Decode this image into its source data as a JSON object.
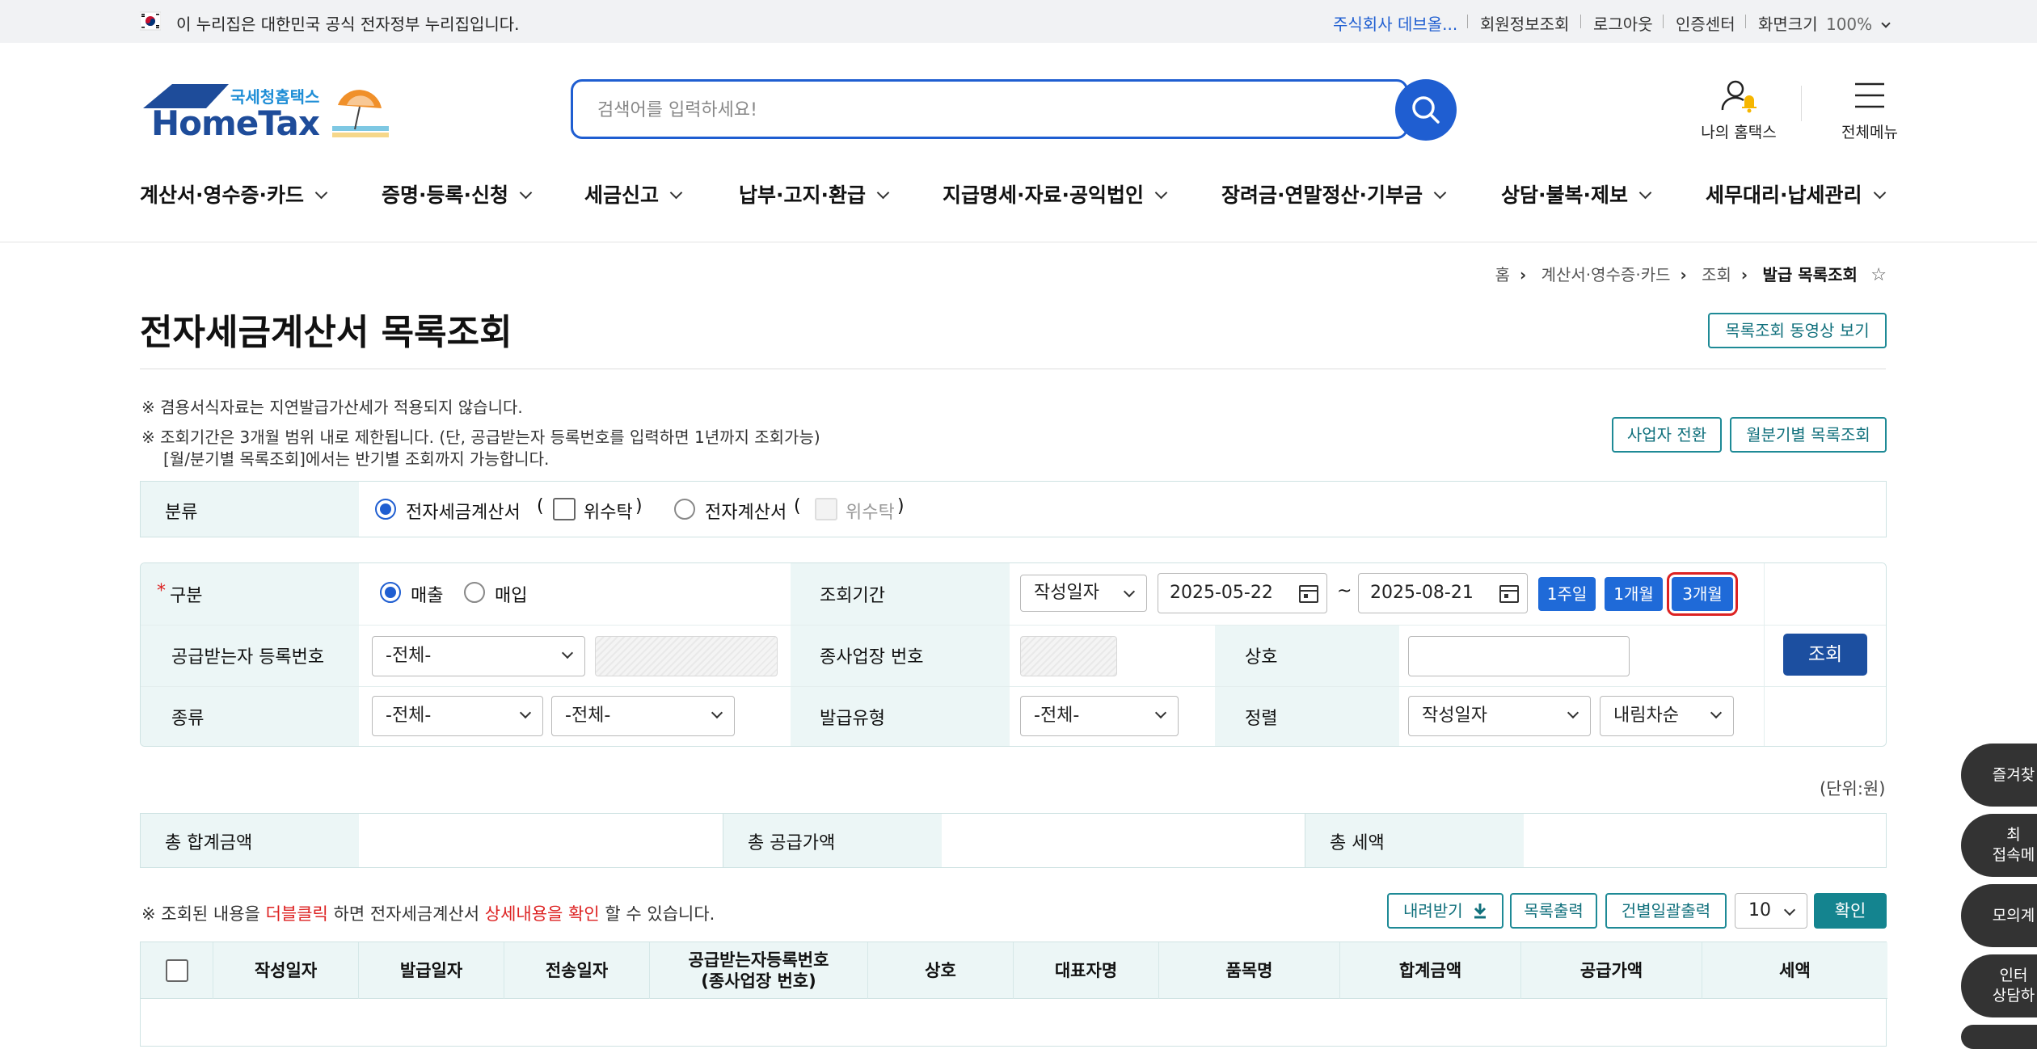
{
  "gov_bar": {
    "notice": "이 누리집은 대한민국 공식 전자정부 누리집입니다.",
    "company_link": "주식회사 데브올...",
    "member_info": "회원정보조회",
    "logout": "로그아웃",
    "auth_center": "인증센터",
    "screen_size_label": "화면크기",
    "screen_size_value": "100%"
  },
  "header": {
    "logo_sub": "국세청홈택스",
    "logo_main": "HomeTax",
    "search_placeholder": "검색어를 입력하세요!",
    "my_hometax": "나의 홈택스",
    "all_menu": "전체메뉴"
  },
  "nav": [
    {
      "label": "계산서·영수증·카드"
    },
    {
      "label": "증명·등록·신청"
    },
    {
      "label": "세금신고"
    },
    {
      "label": "납부·고지·환급"
    },
    {
      "label": "지급명세·자료·공익법인"
    },
    {
      "label": "장려금·연말정산·기부금"
    },
    {
      "label": "상담·불복·제보"
    },
    {
      "label": "세무대리·납세관리"
    }
  ],
  "breadcrumb": [
    "홈",
    "계산서·영수증·카드",
    "조회",
    "발급 목록조회"
  ],
  "page": {
    "title": "전자세금계산서 목록조회",
    "video_button": "목록조회 동영상 보기",
    "switch_business": "사업자 전환",
    "monthly_query": "월분기별 목록조회",
    "note1": "※ 겸용서식자료는 지연발급가산세가 적용되지 않습니다.",
    "note2": "※ 조회기간은 3개월 범위 내로 제한됩니다. (단, 공급받는자 등록번호를 입력하면 1년까지 조회가능)",
    "note3": "[월/분기별 목록조회]에서는 반기별 조회까지 가능합니다."
  },
  "classification": {
    "label": "분류",
    "opt1": "전자세금계산서",
    "paren_open": "(",
    "paren_close": ")",
    "consign": "위수탁",
    "opt2": "전자계산서"
  },
  "query": {
    "type_label": "구분",
    "sales": "매출",
    "purchase": "매입",
    "period_label": "조회기간",
    "date_type": "작성일자",
    "start_date": "2025-05-22",
    "tilde": "~",
    "end_date": "2025-08-21",
    "p1w": "1주일",
    "p1m": "1개월",
    "p3m": "3개월",
    "buyer_reg_label": "공급받는자 등록번호",
    "buyer_reg_select": "-전체-",
    "branch_label": "종사업장 번호",
    "company_label": "상호",
    "kind_label": "종류",
    "kind1": "-전체-",
    "kind2": "-전체-",
    "issue_type_label": "발급유형",
    "issue_type": "-전체-",
    "sort_label": "정렬",
    "sort_field": "작성일자",
    "sort_order": "내림차순",
    "search_button": "조회"
  },
  "totals": {
    "unit": "(단위:원)",
    "total_label": "총 합계금액",
    "supply_label": "총 공급가액",
    "tax_label": "총 세액"
  },
  "list_toolbar": {
    "note_prefix": "※ 조회된 내용을",
    "note_dbl": "더블클릭",
    "note_mid": "하면 전자세금계산서",
    "note_detail": "상세내용을 확인",
    "note_suffix": "할 수 있습니다.",
    "download": "내려받기",
    "print_list": "목록출력",
    "print_batch": "건별일괄출력",
    "page_size": "10",
    "confirm": "확인"
  },
  "table": {
    "columns": [
      "작성일자",
      "발급일자",
      "전송일자",
      "공급받는자등록번호",
      "(종사업장 번호)",
      "상호",
      "대표자명",
      "품목명",
      "합계금액",
      "공급가액",
      "세액"
    ]
  },
  "side_quick": [
    "즐겨찾",
    "최",
    "접속메",
    "모의계",
    "인터",
    "상담하"
  ],
  "colors": {
    "brand_blue": "#1f5ed1",
    "teal": "#1e8a96",
    "highlight_red": "#d22"
  }
}
